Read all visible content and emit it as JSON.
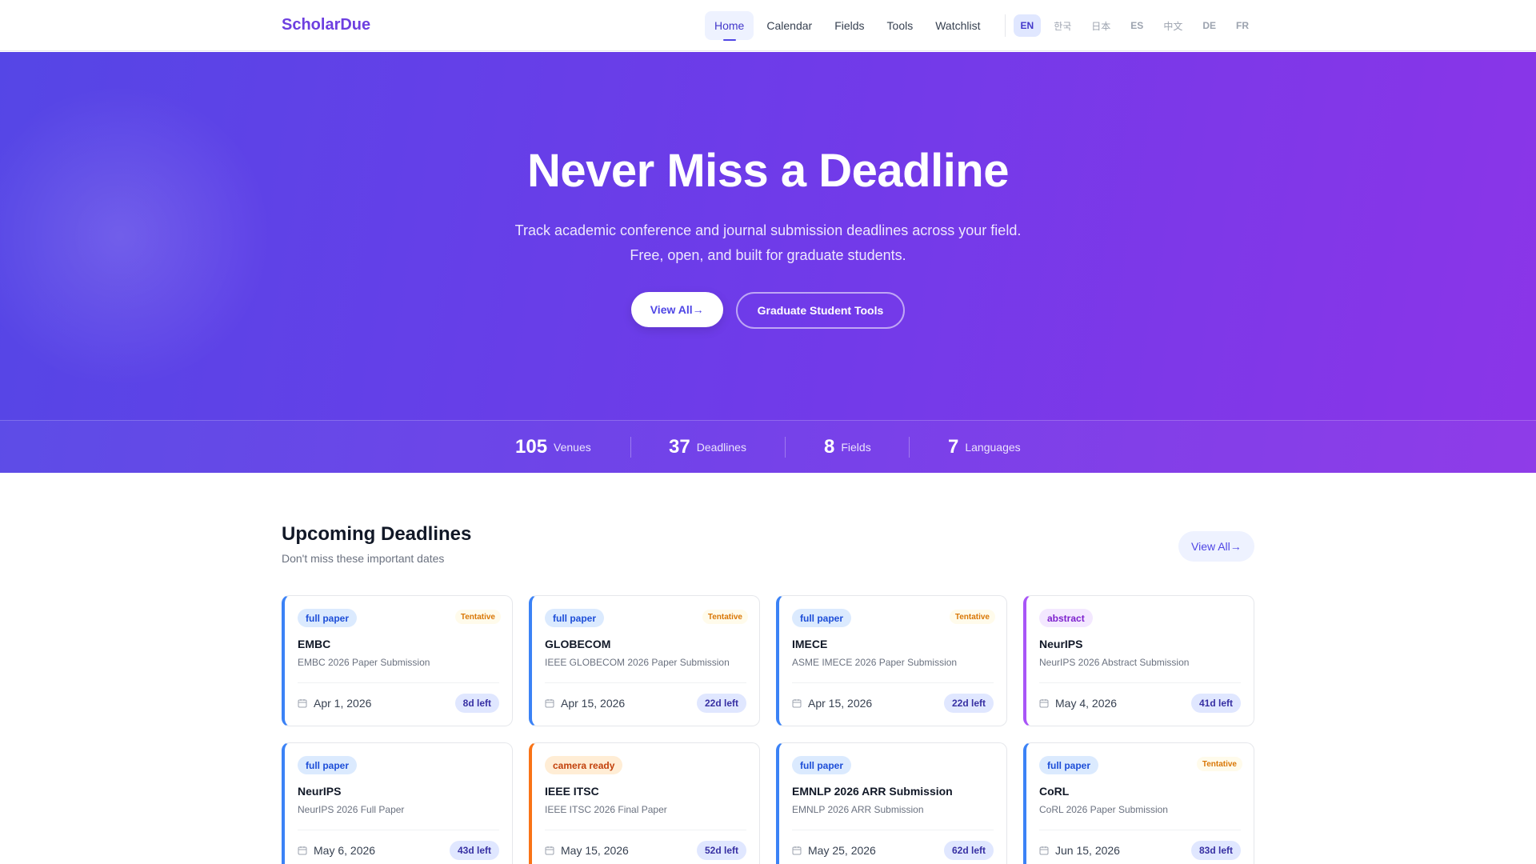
{
  "nav": {
    "brand": "ScholarDue",
    "links": [
      {
        "label": "Home",
        "active": true
      },
      {
        "label": "Calendar"
      },
      {
        "label": "Fields"
      },
      {
        "label": "Tools"
      },
      {
        "label": "Watchlist"
      }
    ],
    "languages": [
      {
        "label": "EN",
        "active": true
      },
      {
        "label": "한국"
      },
      {
        "label": "日本"
      },
      {
        "label": "ES"
      },
      {
        "label": "中文"
      },
      {
        "label": "DE"
      },
      {
        "label": "FR"
      }
    ]
  },
  "hero": {
    "title": "Never Miss a Deadline",
    "subtitle_line1": "Track academic conference and journal submission deadlines across your field.",
    "subtitle_line2": "Free, open, and built for graduate students.",
    "primary_button": "View All→",
    "secondary_button": "Graduate Student Tools"
  },
  "stats": [
    {
      "value": "105",
      "label": "Venues"
    },
    {
      "value": "37",
      "label": "Deadlines"
    },
    {
      "value": "8",
      "label": "Fields"
    },
    {
      "value": "7",
      "label": "Languages"
    }
  ],
  "upcoming": {
    "title": "Upcoming Deadlines",
    "subtitle": "Don't miss these important dates",
    "view_all": "View All→",
    "cards": [
      {
        "type": "full paper",
        "tentative": "Tentative",
        "name": "EMBC",
        "desc": "EMBC 2026 Paper Submission",
        "date": "Apr 1, 2026",
        "days_left": "8d left"
      },
      {
        "type": "full paper",
        "tentative": "Tentative",
        "name": "GLOBECOM",
        "desc": "IEEE GLOBECOM 2026 Paper Submission",
        "date": "Apr 15, 2026",
        "days_left": "22d left"
      },
      {
        "type": "full paper",
        "tentative": "Tentative",
        "name": "IMECE",
        "desc": "ASME IMECE 2026 Paper Submission",
        "date": "Apr 15, 2026",
        "days_left": "22d left"
      },
      {
        "type": "abstract",
        "tentative": "",
        "name": "NeurIPS",
        "desc": "NeurIPS 2026 Abstract Submission",
        "date": "May 4, 2026",
        "days_left": "41d left"
      },
      {
        "type": "full paper",
        "tentative": "",
        "name": "NeurIPS",
        "desc": "NeurIPS 2026 Full Paper",
        "date": "May 6, 2026",
        "days_left": "43d left"
      },
      {
        "type": "camera ready",
        "tentative": "",
        "name": "IEEE ITSC",
        "desc": "IEEE ITSC 2026 Final Paper",
        "date": "May 15, 2026",
        "days_left": "52d left"
      },
      {
        "type": "full paper",
        "tentative": "",
        "name": "EMNLP 2026 ARR Submission",
        "desc": "EMNLP 2026 ARR Submission",
        "date": "May 25, 2026",
        "days_left": "62d left"
      },
      {
        "type": "full paper",
        "tentative": "Tentative",
        "name": "CoRL",
        "desc": "CoRL 2026 Paper Submission",
        "date": "Jun 15, 2026",
        "days_left": "83d left"
      }
    ]
  },
  "colors": {
    "brand": "#6d3fe0",
    "accent": "#4f46e5",
    "hero_start": "#5546e6",
    "hero_end": "#8b35e8",
    "full_paper": "#3b82f6",
    "abstract": "#a855f7",
    "camera_ready": "#f97316"
  }
}
